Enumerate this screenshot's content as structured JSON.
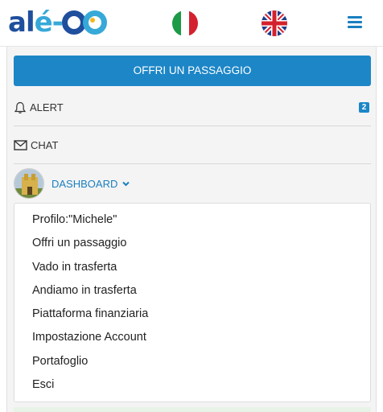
{
  "header": {
    "logo_text": "alé-oo",
    "flags": [
      "italian-flag",
      "english-flag"
    ],
    "menu_icon": "hamburger-icon"
  },
  "menu": {
    "cta_label": "OFFRI UN PASSAGGIO",
    "alert_label": "ALERT",
    "alert_count": "2",
    "chat_label": "CHAT",
    "dashboard_label": "DASHBOARD",
    "dropdown_items": [
      "Profilo:\"Michele\"",
      "Offri un passaggio",
      "Vado in trasferta",
      "Andiamo in trasferta",
      "Piattaforma finanziaria",
      "Impostazione Account",
      "Portafoglio",
      "Esci"
    ]
  },
  "colors": {
    "accent": "#1c86c7",
    "logo_dark": "#1f4f9d",
    "logo_light": "#36a9d8"
  }
}
